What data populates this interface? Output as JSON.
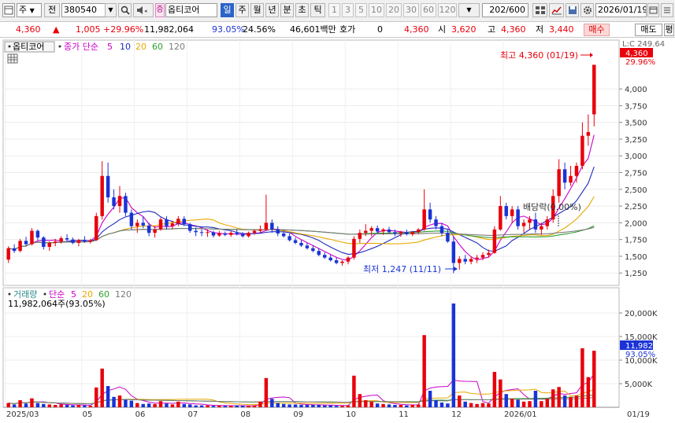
{
  "toolbar": {
    "market": "주",
    "prev_label": "전",
    "code": "380540",
    "stock_icon": "증",
    "stock_name": "옵티코어",
    "periods": [
      "일",
      "주",
      "월",
      "년",
      "분",
      "초",
      "틱"
    ],
    "period_selected": "일",
    "intervals": [
      "1",
      "3",
      "5",
      "10",
      "20",
      "30",
      "60",
      "120"
    ],
    "count": "202",
    "count_total": "/600",
    "date": "2026/01/19"
  },
  "quote": {
    "price": "4,360",
    "change": "1,005",
    "change_pct": "+29.96%",
    "volume": "11,982,064",
    "volume_ratio": "93.05%",
    "turnover_rate": "24.56%",
    "amount": "46,601백만",
    "hoga_label": "호가",
    "hoga_value": "0",
    "hoga_price": "4,360",
    "open_label": "시",
    "open": "3,620",
    "high_label": "고",
    "high": "4,360",
    "low_label": "저",
    "low": "3,440",
    "buy_label": "매수",
    "sell_label": "매도",
    "flat_label": "평"
  },
  "price_panel": {
    "legend_name": "옵티코어",
    "legend_ma_title": "종가 단순",
    "ma_periods": [
      "5",
      "10",
      "20",
      "60",
      "120"
    ],
    "ma_colors": [
      "#c800c8",
      "#1f2bbd",
      "#e6a800",
      "#2e9e2e",
      "#7a7a7a"
    ],
    "last_price_tag": "4,360",
    "last_pct_tag": "29.96%",
    "top_value": "L:C 249.64",
    "max_annotation": "최고 4,360 (01/19)",
    "min_annotation": "최저 1,247 (11/11)",
    "dividend_annotation": "배당락(0.00%)"
  },
  "volume_panel": {
    "legend_title": "거래량",
    "legend_ma_title": "단순",
    "ma_periods": [
      "5",
      "20",
      "60",
      "120"
    ],
    "info": "11,982,064주(93.05%)",
    "last_volume_tag": "11,982K",
    "last_pct_tag": "93.05%"
  },
  "x_axis": [
    "2025/03",
    "05",
    "06",
    "07",
    "08",
    "09",
    "10",
    "11",
    "12",
    "2026/01",
    "01/19"
  ],
  "colors": {
    "up": "#e8000b",
    "down": "#1a33d6",
    "accent": "#2b63c8"
  },
  "chart_data": {
    "type": "candlestick",
    "price_axis": [
      "4,000",
      "3,750",
      "3,500",
      "3,250",
      "3,000",
      "2,750",
      "2,500",
      "2,250",
      "2,000",
      "1,750",
      "1,500",
      "1,250"
    ],
    "volume_axis": [
      "20,000K",
      "15,000K",
      "10,000K",
      "5,000K"
    ],
    "price_range": [
      1100,
      4600
    ],
    "volume_range": [
      0,
      23000
    ],
    "max_price": 4360,
    "min_price": 1247,
    "candles": [
      [
        1450,
        1650,
        1400,
        1620,
        900
      ],
      [
        1620,
        1680,
        1550,
        1580,
        600
      ],
      [
        1580,
        1760,
        1560,
        1730,
        1500
      ],
      [
        1730,
        1790,
        1650,
        1680,
        800
      ],
      [
        1680,
        1920,
        1660,
        1880,
        1900
      ],
      [
        1880,
        1900,
        1740,
        1780,
        900
      ],
      [
        1780,
        1800,
        1600,
        1640,
        700
      ],
      [
        1640,
        1720,
        1580,
        1700,
        600
      ],
      [
        1700,
        1760,
        1650,
        1720,
        500
      ],
      [
        1720,
        1800,
        1690,
        1770,
        600
      ],
      [
        1770,
        1830,
        1720,
        1750,
        500
      ],
      [
        1750,
        1780,
        1680,
        1700,
        400
      ],
      [
        1700,
        1760,
        1650,
        1740,
        500
      ],
      [
        1740,
        1800,
        1700,
        1720,
        400
      ],
      [
        1720,
        1760,
        1690,
        1740,
        300
      ],
      [
        1740,
        2150,
        1730,
        2100,
        4200
      ],
      [
        2100,
        2920,
        2050,
        2700,
        8200
      ],
      [
        2700,
        2900,
        2300,
        2380,
        4500
      ],
      [
        2380,
        2500,
        2200,
        2250,
        2200
      ],
      [
        2250,
        2550,
        2150,
        2400,
        2500
      ],
      [
        2400,
        2450,
        2100,
        2150,
        1600
      ],
      [
        2150,
        2200,
        1900,
        1950,
        1400
      ],
      [
        1950,
        2050,
        1850,
        2000,
        900
      ],
      [
        2000,
        2100,
        1920,
        1960,
        700
      ],
      [
        1960,
        2000,
        1800,
        1850,
        800
      ],
      [
        1850,
        1950,
        1780,
        1900,
        700
      ],
      [
        1900,
        2080,
        1880,
        2050,
        1300
      ],
      [
        2050,
        2100,
        1900,
        1950,
        800
      ],
      [
        1950,
        2030,
        1900,
        1990,
        600
      ],
      [
        1990,
        2100,
        1950,
        2060,
        1200
      ],
      [
        2060,
        2100,
        1950,
        1980,
        700
      ],
      [
        1980,
        2000,
        1850,
        1880,
        600
      ],
      [
        1880,
        1930,
        1800,
        1860,
        400
      ],
      [
        1860,
        1900,
        1800,
        1850,
        400
      ],
      [
        1850,
        1900,
        1790,
        1860,
        400
      ],
      [
        1860,
        1880,
        1780,
        1810,
        300
      ],
      [
        1810,
        1880,
        1790,
        1840,
        400
      ],
      [
        1840,
        1870,
        1800,
        1820,
        300
      ],
      [
        1820,
        1880,
        1790,
        1850,
        300
      ],
      [
        1850,
        1900,
        1810,
        1830,
        400
      ],
      [
        1830,
        1860,
        1780,
        1800,
        300
      ],
      [
        1800,
        1870,
        1780,
        1850,
        300
      ],
      [
        1850,
        1900,
        1820,
        1880,
        400
      ],
      [
        1880,
        1960,
        1850,
        1900,
        1200
      ],
      [
        1900,
        2420,
        1880,
        2000,
        6200
      ],
      [
        2000,
        2050,
        1850,
        1900,
        1800
      ],
      [
        1900,
        1950,
        1800,
        1840,
        900
      ],
      [
        1840,
        1880,
        1780,
        1800,
        700
      ],
      [
        1800,
        1840,
        1720,
        1740,
        600
      ],
      [
        1740,
        1780,
        1680,
        1700,
        600
      ],
      [
        1700,
        1740,
        1640,
        1660,
        500
      ],
      [
        1660,
        1700,
        1600,
        1620,
        500
      ],
      [
        1620,
        1660,
        1560,
        1580,
        500
      ],
      [
        1580,
        1620,
        1500,
        1520,
        500
      ],
      [
        1520,
        1560,
        1460,
        1480,
        400
      ],
      [
        1480,
        1520,
        1420,
        1440,
        400
      ],
      [
        1440,
        1480,
        1380,
        1400,
        300
      ],
      [
        1400,
        1440,
        1360,
        1420,
        300
      ],
      [
        1420,
        1500,
        1380,
        1480,
        400
      ],
      [
        1480,
        1800,
        1450,
        1760,
        6700
      ],
      [
        1760,
        1900,
        1700,
        1850,
        2800
      ],
      [
        1850,
        1980,
        1800,
        1880,
        1500
      ],
      [
        1880,
        1950,
        1800,
        1920,
        1200
      ],
      [
        1920,
        1960,
        1850,
        1870,
        800
      ],
      [
        1870,
        1920,
        1820,
        1900,
        700
      ],
      [
        1900,
        1940,
        1840,
        1860,
        600
      ],
      [
        1860,
        1900,
        1800,
        1840,
        500
      ],
      [
        1840,
        1880,
        1790,
        1860,
        500
      ],
      [
        1860,
        1900,
        1810,
        1830,
        400
      ],
      [
        1830,
        1880,
        1800,
        1860,
        500
      ],
      [
        1860,
        1920,
        1830,
        1900,
        600
      ],
      [
        1900,
        2500,
        1880,
        2200,
        15300
      ],
      [
        2200,
        2300,
        2000,
        2050,
        3500
      ],
      [
        2050,
        2100,
        1900,
        1950,
        1500
      ],
      [
        1950,
        2000,
        1800,
        1850,
        1000
      ],
      [
        1850,
        1900,
        1700,
        1720,
        800
      ],
      [
        1720,
        1800,
        1247,
        1400,
        22000
      ],
      [
        1400,
        1500,
        1300,
        1460,
        2500
      ],
      [
        1460,
        1520,
        1380,
        1420,
        1200
      ],
      [
        1420,
        1500,
        1380,
        1460,
        900
      ],
      [
        1460,
        1520,
        1400,
        1480,
        700
      ],
      [
        1480,
        1560,
        1440,
        1520,
        900
      ],
      [
        1520,
        1600,
        1480,
        1550,
        800
      ],
      [
        1550,
        1950,
        1540,
        1900,
        7500
      ],
      [
        1900,
        2400,
        1880,
        2250,
        5900
      ],
      [
        2250,
        2300,
        2050,
        2100,
        2800
      ],
      [
        2100,
        2250,
        2000,
        2200,
        1800
      ],
      [
        2200,
        2250,
        1900,
        1950,
        1600
      ],
      [
        1950,
        2050,
        1850,
        2000,
        1200
      ],
      [
        2000,
        2100,
        1900,
        2050,
        1300
      ],
      [
        2050,
        2150,
        1850,
        1900,
        3500
      ],
      [
        1900,
        2000,
        1820,
        1950,
        1300
      ],
      [
        1950,
        2100,
        1900,
        2050,
        1800
      ],
      [
        2050,
        2500,
        2000,
        2400,
        3800
      ],
      [
        2400,
        2950,
        2300,
        2800,
        4300
      ],
      [
        2800,
        2900,
        2500,
        2600,
        2500
      ],
      [
        2600,
        2850,
        2550,
        2700,
        2200
      ],
      [
        2700,
        2900,
        2600,
        2850,
        2500
      ],
      [
        2850,
        3500,
        2800,
        3300,
        12500
      ],
      [
        3300,
        3620,
        3150,
        3355,
        6400
      ],
      [
        3620,
        4360,
        3440,
        4360,
        11982
      ]
    ]
  }
}
